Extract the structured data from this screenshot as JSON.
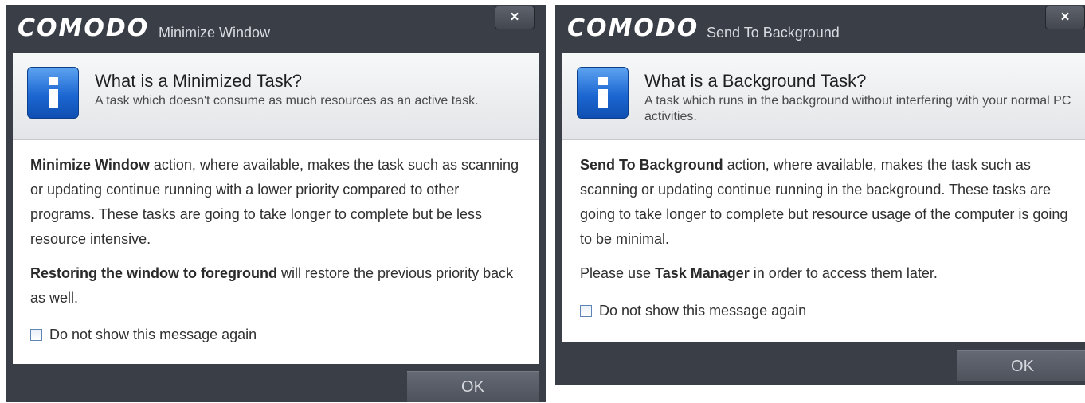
{
  "dialogs": [
    {
      "brand": "COMODO",
      "window_title": "Minimize Window",
      "close_glyph": "×",
      "header_title": "What is a Minimized Task?",
      "header_subtitle": "A task which doesn't consume as much resources as an active task.",
      "icon": "info-icon",
      "paragraph1_bold": "Minimize Window",
      "paragraph1_rest": " action, where available, makes the task such as scanning or updating continue running with a lower priority compared to other programs. These tasks are going to take longer to complete but be less resource intensive.",
      "paragraph2_bold": "Restoring the window to foreground",
      "paragraph2_rest": " will restore the previous priority back as well.",
      "checkbox_label": "Do not show this message again",
      "ok_label": "OK"
    },
    {
      "brand": "COMODO",
      "window_title": "Send To Background",
      "close_glyph": "×",
      "header_title": "What is a Background Task?",
      "header_subtitle": "A task which runs in the background without interfering with your normal PC activities.",
      "icon": "info-icon",
      "paragraph1_bold": "Send To Background",
      "paragraph1_rest": " action, where available, makes the task such as scanning or updating continue running in the background. These tasks are going to take longer to complete but resource usage of the computer is going to be minimal.",
      "paragraph2_prefix": "Please use ",
      "paragraph2_bold": "Task Manager",
      "paragraph2_rest": " in order to access them later.",
      "checkbox_label": "Do not show this message again",
      "ok_label": "OK"
    }
  ],
  "colors": {
    "dialog_bg": "#3a3e47",
    "panel_bg": "#ffffff",
    "icon_blue": "#1c67d2"
  }
}
